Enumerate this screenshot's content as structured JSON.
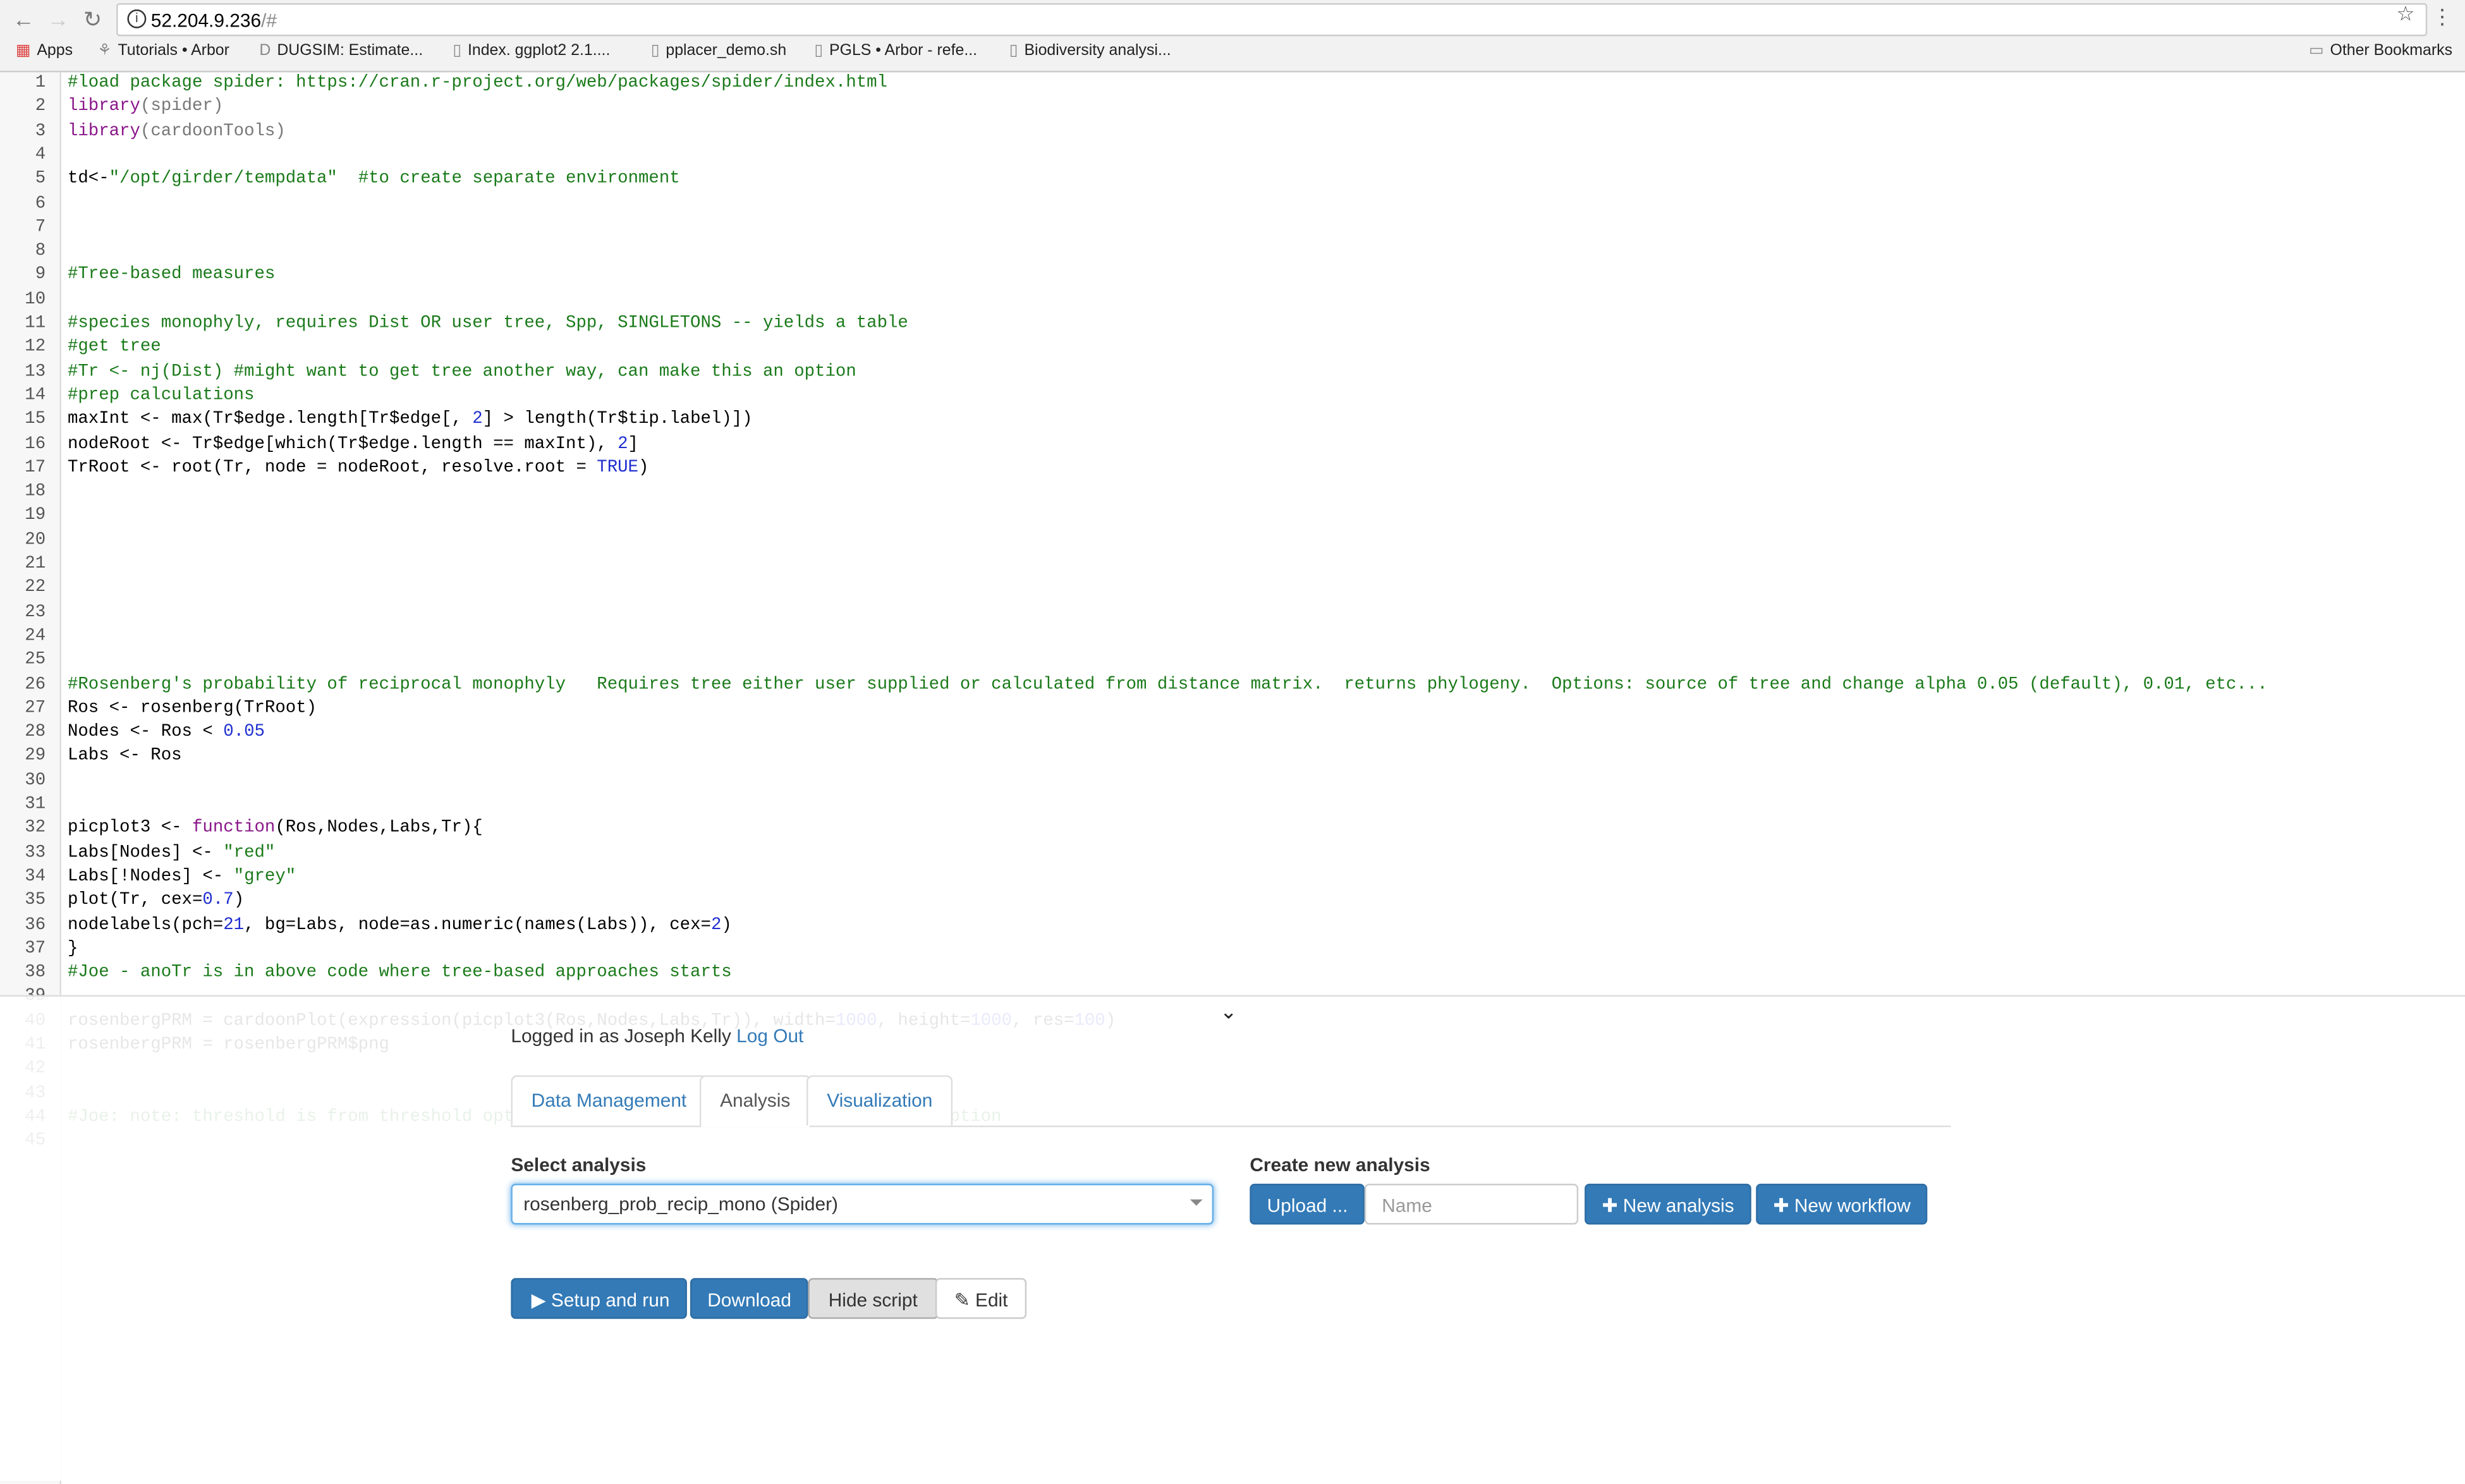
{
  "browser": {
    "url_host": "52.204.9.236",
    "url_path": "/#",
    "bookmarks": [
      {
        "label": "Apps",
        "icon": "apps-grid-icon"
      },
      {
        "label": "Tutorials • Arbor",
        "icon": "arbor-icon"
      },
      {
        "label": "DUGSIM: Estimate...",
        "icon": "d-icon"
      },
      {
        "label": "Index. ggplot2 2.1....",
        "icon": "page-icon"
      },
      {
        "label": "pplacer_demo.sh",
        "icon": "page-icon"
      },
      {
        "label": "PGLS • Arbor - refe...",
        "icon": "page-icon"
      },
      {
        "label": "Biodiversity analysi...",
        "icon": "page-icon"
      }
    ],
    "other_bookmarks": "Other Bookmarks"
  },
  "editor": {
    "lines": [
      [
        [
          "#load package spider: https://cran.r-project.org/web/packages/spider/index.html",
          "comment"
        ]
      ],
      [
        [
          "library",
          "kw"
        ],
        [
          "(spider)",
          "op"
        ]
      ],
      [
        [
          "library",
          "kw"
        ],
        [
          "(cardoonTools)",
          "op"
        ]
      ],
      [],
      [
        [
          "td<-",
          "n"
        ],
        [
          "\"/opt/girder/tempdata\"",
          "str"
        ],
        [
          "  ",
          "n"
        ],
        [
          "#to create separate environment",
          "comment"
        ]
      ],
      [],
      [],
      [],
      [
        [
          "#Tree-based measures",
          "comment"
        ]
      ],
      [],
      [
        [
          "#species monophyly, requires Dist OR user tree, Spp, SINGLETONS -- yields a table",
          "comment"
        ]
      ],
      [
        [
          "#get tree",
          "comment"
        ]
      ],
      [
        [
          "#Tr <- nj(Dist) #might want to get tree another way, can make this an option",
          "comment"
        ]
      ],
      [
        [
          "#prep calculations",
          "comment"
        ]
      ],
      [
        [
          "maxInt <- max(Tr$edge.length[Tr$edge[, ",
          "n"
        ],
        [
          "2",
          "num"
        ],
        [
          "] > length(Tr$tip.label)])",
          "n"
        ]
      ],
      [
        [
          "nodeRoot <- Tr$edge[which(Tr$edge.length == maxInt), ",
          "n"
        ],
        [
          "2",
          "num"
        ],
        [
          "]",
          "n"
        ]
      ],
      [
        [
          "TrRoot <- root(Tr, node = nodeRoot, resolve.root = ",
          "n"
        ],
        [
          "TRUE",
          "num"
        ],
        [
          ")",
          "n"
        ]
      ],
      [],
      [],
      [],
      [],
      [],
      [],
      [],
      [],
      [
        [
          "#Rosenberg's probability of reciprocal monophyly   Requires tree either user supplied or calculated from distance matrix.  returns phylogeny.  Options: source of tree and change alpha 0.05 (default), 0.01, etc...",
          "comment"
        ]
      ],
      [
        [
          "Ros <- rosenberg(TrRoot)",
          "n"
        ]
      ],
      [
        [
          "Nodes <- Ros < ",
          "n"
        ],
        [
          "0.05",
          "num"
        ]
      ],
      [
        [
          "Labs <- Ros",
          "n"
        ]
      ],
      [],
      [],
      [
        [
          "picplot3 <- ",
          "n"
        ],
        [
          "function",
          "kw"
        ],
        [
          "(Ros,Nodes,Labs,Tr){",
          "n"
        ]
      ],
      [
        [
          "Labs[Nodes] <- ",
          "n"
        ],
        [
          "\"red\"",
          "str"
        ]
      ],
      [
        [
          "Labs[!Nodes] <- ",
          "n"
        ],
        [
          "\"grey\"",
          "str"
        ]
      ],
      [
        [
          "plot(Tr, cex=",
          "n"
        ],
        [
          "0.7",
          "num"
        ],
        [
          ")",
          "n"
        ]
      ],
      [
        [
          "nodelabels(pch=",
          "n"
        ],
        [
          "21",
          "num"
        ],
        [
          ", bg=Labs, node=as.numeric(names(Labs)), cex=",
          "n"
        ],
        [
          "2",
          "num"
        ],
        [
          ")",
          "n"
        ]
      ],
      [
        [
          "}",
          "n"
        ]
      ],
      [
        [
          "#Joe - anoTr is in above code where tree-based approaches starts",
          "comment"
        ]
      ],
      [],
      [
        [
          "rosenbergPRM = cardoonPlot(expression(picplot3(Ros,Nodes,Labs,Tr)), width=",
          "n"
        ],
        [
          "1000",
          "num"
        ],
        [
          ", height=",
          "n"
        ],
        [
          "1000",
          "num"
        ],
        [
          ", res=",
          "n"
        ],
        [
          "100",
          "num"
        ],
        [
          ")",
          "n"
        ]
      ],
      [
        [
          "rosenbergPRM = rosenbergPRM$png",
          "n"
        ]
      ],
      [],
      [],
      [
        [
          "#Joe: note: threshold is from threshold optimization test.             make this an option",
          "comment"
        ]
      ],
      []
    ]
  },
  "panel": {
    "logged_in_prefix": "Logged in as Joseph Kelly",
    "logout": "Log Out",
    "tabs": [
      "Data Management",
      "Analysis",
      "Visualization"
    ],
    "active_tab": "Analysis",
    "select_label": "Select analysis",
    "selected_analysis": "rosenberg_prob_recip_mono (Spider)",
    "create_label": "Create new analysis",
    "upload": "Upload ...",
    "name_placeholder": "Name",
    "new_analysis": "New analysis",
    "new_workflow": "New workflow",
    "setup_run": "Setup and run",
    "download": "Download",
    "hide_script": "Hide script",
    "edit": "Edit"
  }
}
